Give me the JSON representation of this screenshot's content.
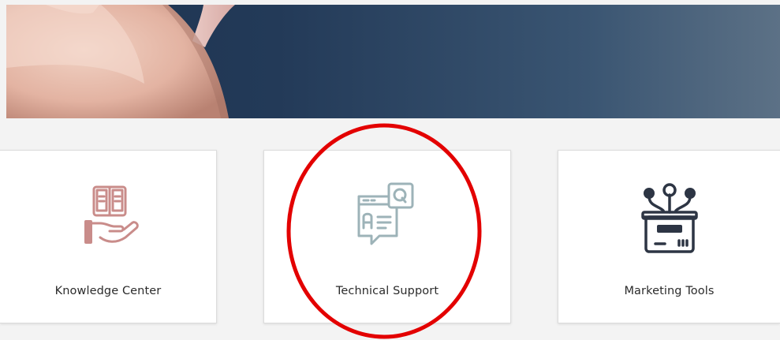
{
  "cards": [
    {
      "label": "Knowledge Center",
      "icon": "book-hand-icon"
    },
    {
      "label": "Technical Support",
      "icon": "support-chat-icon"
    },
    {
      "label": "Marketing Tools",
      "icon": "marketing-box-icon"
    }
  ],
  "colors": {
    "hero_dark": "#1c3350",
    "hero_light": "#5c7186",
    "knowledge_icon": "#c98c8a",
    "support_icon": "#9db3b8",
    "marketing_icon": "#2d3544",
    "annotation": "#e30000"
  }
}
